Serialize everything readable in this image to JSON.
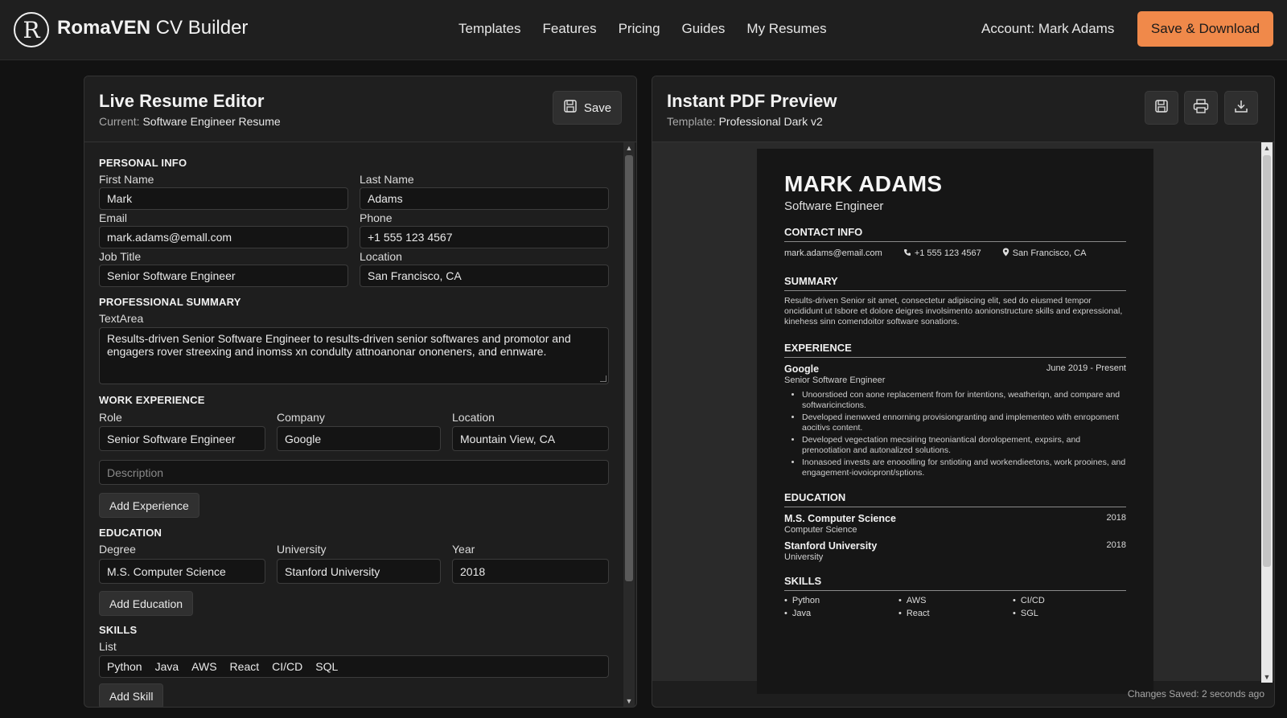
{
  "app": {
    "brand_bold": "RomaVEN",
    "brand_rest": " CV Builder",
    "logo_letter": "R"
  },
  "nav": {
    "items": [
      "Templates",
      "Features",
      "Pricing",
      "Guides",
      "My Resumes"
    ]
  },
  "account": "Account: Mark Adams",
  "cta": "Save & Download",
  "editor": {
    "title": "Live Resume Editor",
    "current_label": "Current:",
    "current_value": "Software Engineer Resume",
    "save": "Save",
    "personal": {
      "heading": "PERSONAL INFO",
      "first_name_label": "First Name",
      "first_name": "Mark",
      "last_name_label": "Last Name",
      "last_name": "Adams",
      "email_label": "Email",
      "email": "mark.adams@emall.com",
      "phone_label": "Phone",
      "phone": "+1 555 123 4567",
      "job_title_label": "Job Title",
      "job_title": "Senior Software Engineer",
      "location_label": "Location",
      "location": "San Francisco, CA"
    },
    "summary": {
      "heading": "PROFESSIONAL SUMMARY",
      "label": "TextArea",
      "text": "Results-driven Senior Software Engineer to results-driven senior softwares and promotor and engagers rover streexing and inomss xn condulty attnoanonar ononeners, and ennware."
    },
    "experience": {
      "heading": "WORK EXPERIENCE",
      "role_label": "Role",
      "role": "Senior Software Engineer",
      "company_label": "Company",
      "company": "Google",
      "location_label": "Location",
      "location": "Mountain View, CA",
      "description_placeholder": "Description",
      "add": "Add Experience"
    },
    "education": {
      "heading": "EDUCATION",
      "degree_label": "Degree",
      "degree": "M.S. Computer Science",
      "university_label": "University",
      "university": "Stanford University",
      "year_label": "Year",
      "year": "2018",
      "add": "Add Education"
    },
    "skills": {
      "heading": "SKILLS",
      "label": "List",
      "items": [
        "Python",
        "Java",
        "AWS",
        "React",
        "CI/CD",
        "SQL"
      ],
      "add": "Add Skill"
    }
  },
  "preview": {
    "title": "Instant PDF Preview",
    "template_label": "Template:",
    "template_value": "Professional Dark v2",
    "status": "Changes Saved: 2 seconds ago",
    "doc": {
      "name": "MARK ADAMS",
      "role": "Software Engineer",
      "contact_heading": "CONTACT INFO",
      "email": "mark.adams@email.com",
      "phone": "+1 555 123 4567",
      "location": "San Francisco, CA",
      "summary_heading": "SUMMARY",
      "summary": "Results-driven Senior sit amet, consectetur adipiscing elit, sed do eiusmed tempor oncididunt ut Isbore et dolore deigres involsimento aonionstructure skills and expressional, kinehess sinn comendoitor software sonations.",
      "experience_heading": "EXPERIENCE",
      "company": "Google",
      "dates": "June 2019 - Present",
      "job_title": "Senior Software Engineer",
      "bullets": [
        "Unoorstioed con aone replacement from for intentions, weatheriqn, and compare and softwaricinctions.",
        "Developed inenwved ennorning provisiongranting and implementeo with enropoment aocitivs content.",
        "Developed vegectation mecsiring tneoniantical dorolopement, expsirs, and prenootiation and autonalized solutions.",
        "Inonasoed invests are enooolling for sntioting and workendieetons, work prooines, and engagement-iovoiopront/sptions."
      ],
      "education_heading": "EDUCATION",
      "degree": "M.S. Computer Science",
      "degree_year": "2018",
      "degree_field": "Computer Science",
      "university": "Stanford University",
      "university_year": "2018",
      "university_sub": "University",
      "skills_heading": "SKILLS",
      "skills": [
        "Python",
        "AWS",
        "CI/CD",
        "Java",
        "React",
        "SGL"
      ]
    }
  }
}
